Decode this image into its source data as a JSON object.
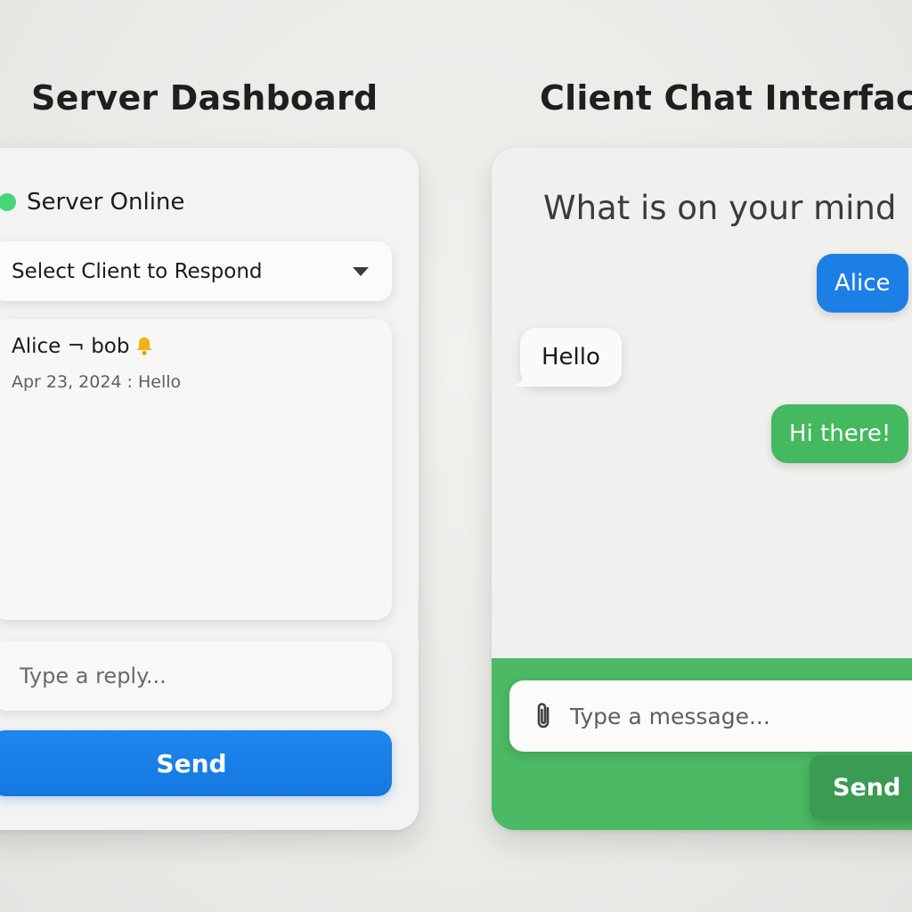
{
  "server": {
    "title": "Server Dashboard",
    "status": {
      "label": "Server Online",
      "color": "#47d67a"
    },
    "client_select": {
      "selected": "Select Client to Respond"
    },
    "messages": [
      {
        "from": "Alice ¬ bob",
        "icon": "bell-icon",
        "meta": "Apr 23, 2024 : Hello"
      }
    ],
    "reply": {
      "placeholder": "Type a reply...",
      "value": ""
    },
    "send_label": "Send",
    "accent": "#1478e0"
  },
  "client": {
    "title": "Client Chat Interface",
    "heading": "What is on your mind",
    "messages": [
      {
        "text": "Alice",
        "side": "right",
        "color": "#1c7fe6"
      },
      {
        "text": "Hello",
        "side": "left",
        "color": "#fafaf9"
      },
      {
        "text": "Hi there!",
        "side": "right",
        "color": "#44b95f"
      }
    ],
    "composer": {
      "placeholder": "Type a message...",
      "value": "",
      "attach_icon": "paperclip-icon",
      "band_color": "#4cb964"
    },
    "send_label": "Send"
  }
}
